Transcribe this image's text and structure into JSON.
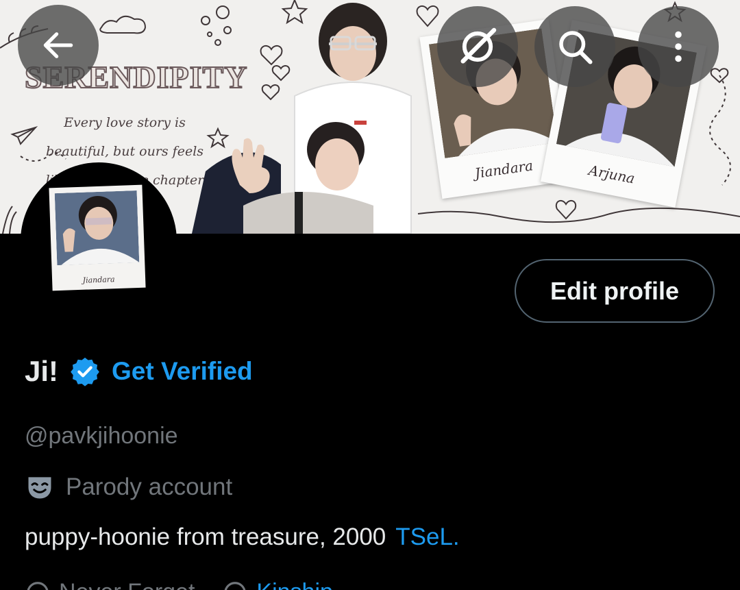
{
  "header": {
    "back_icon": "arrow-left-icon",
    "grok_icon": "grok-icon",
    "search_icon": "search-icon",
    "more_icon": "more-vertical-icon"
  },
  "banner": {
    "title": "SERENDIPITY",
    "quote_line1": "Every love story is",
    "quote_line2": "beautiful, but ours feels",
    "quote_line3": "like my favorite chapter",
    "polaroid_left_caption": "Jiandara",
    "polaroid_right_caption": "Arjuna"
  },
  "avatar": {
    "caption": "Jiandara"
  },
  "actions": {
    "edit_profile_label": "Edit profile"
  },
  "profile": {
    "display_name": "Ji!",
    "get_verified_label": "Get Verified",
    "handle": "@pavkjihoonie",
    "parody_label": "Parody account",
    "bio_text": "puppy-hoonie from treasure, 2000",
    "bio_link": "TSeL.",
    "meta_item1": "Never Forget",
    "meta_item2": "Kinship"
  },
  "colors": {
    "background": "#000000",
    "accent": "#1d9bf0",
    "secondary_text": "#71767b",
    "primary_text": "#e7e9ea"
  }
}
